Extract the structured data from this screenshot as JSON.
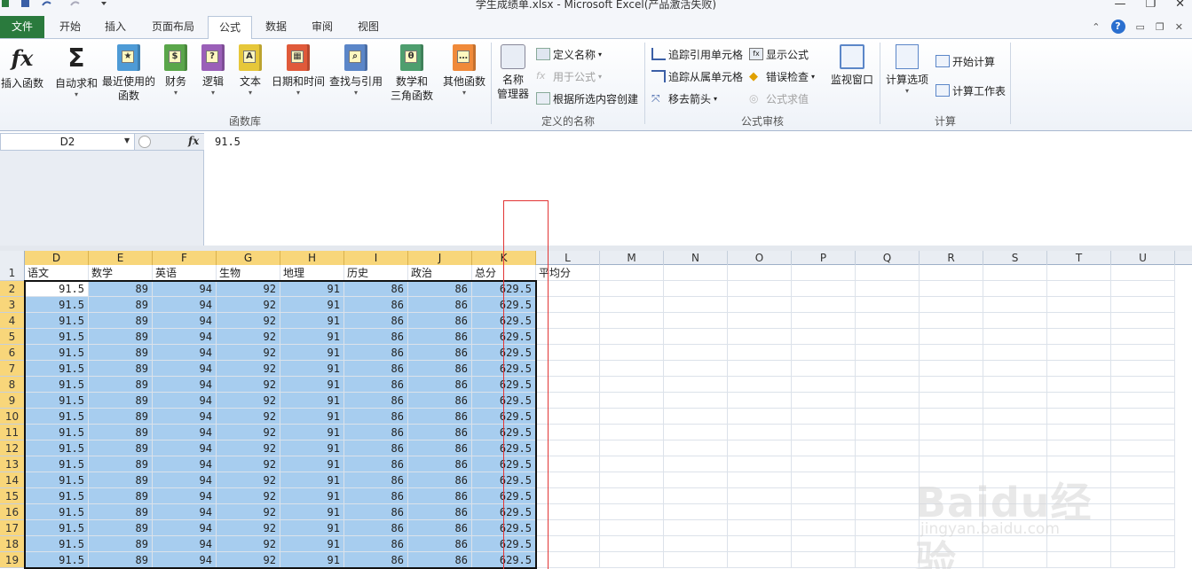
{
  "window": {
    "title": "学生成绩单.xlsx  -  Microsoft Excel(产品激活失败)"
  },
  "tabs": [
    "文件",
    "开始",
    "插入",
    "页面布局",
    "公式",
    "数据",
    "审阅",
    "视图"
  ],
  "active_tab": "公式",
  "ribbon": {
    "function_library": {
      "label": "函数库",
      "insert_function": "插入函数",
      "autosum": "自动求和",
      "recent_line1": "最近使用的",
      "recent_line2": "函数",
      "financial": "财务",
      "logical": "逻辑",
      "text": "文本",
      "datetime": "日期和时间",
      "lookup": "查找与引用",
      "math_line1": "数学和",
      "math_line2": "三角函数",
      "more": "其他函数"
    },
    "defined_names": {
      "label": "定义的名称",
      "name_manager_line1": "名称",
      "name_manager_line2": "管理器",
      "define_name": "定义名称",
      "use_in_formula": "用于公式",
      "create_from_selection": "根据所选内容创建"
    },
    "formula_auditing": {
      "label": "公式审核",
      "trace_precedents": "追踪引用单元格",
      "trace_dependents": "追踪从属单元格",
      "remove_arrows": "移去箭头",
      "show_formulas": "显示公式",
      "error_checking": "错误检查",
      "evaluate_formula": "公式求值",
      "watch_window": "监视窗口"
    },
    "calculation": {
      "label": "计算",
      "calc_options": "计算选项",
      "calc_now": "开始计算",
      "calc_sheet": "计算工作表"
    }
  },
  "formula_bar": {
    "name_box": "D2",
    "fx": "fx",
    "value": "91.5"
  },
  "sheet": {
    "columns": [
      "D",
      "E",
      "F",
      "G",
      "H",
      "I",
      "J",
      "K",
      "L",
      "M",
      "N",
      "O",
      "P",
      "Q",
      "R",
      "S",
      "T",
      "U"
    ],
    "row_numbers": [
      "1",
      "2",
      "3",
      "4",
      "5",
      "6",
      "7",
      "8",
      "9",
      "10",
      "11",
      "12",
      "13",
      "14",
      "15",
      "16",
      "17",
      "18",
      "19"
    ],
    "header_row": [
      "语文",
      "数学",
      "英语",
      "生物",
      "地理",
      "历史",
      "政治",
      "总分",
      "平均分"
    ],
    "data_row": [
      "91.5",
      "89",
      "94",
      "92",
      "91",
      "86",
      "86",
      "629.5"
    ]
  },
  "watermark": {
    "main": "Baidu经验",
    "sub": "jingyan.baidu.com"
  }
}
